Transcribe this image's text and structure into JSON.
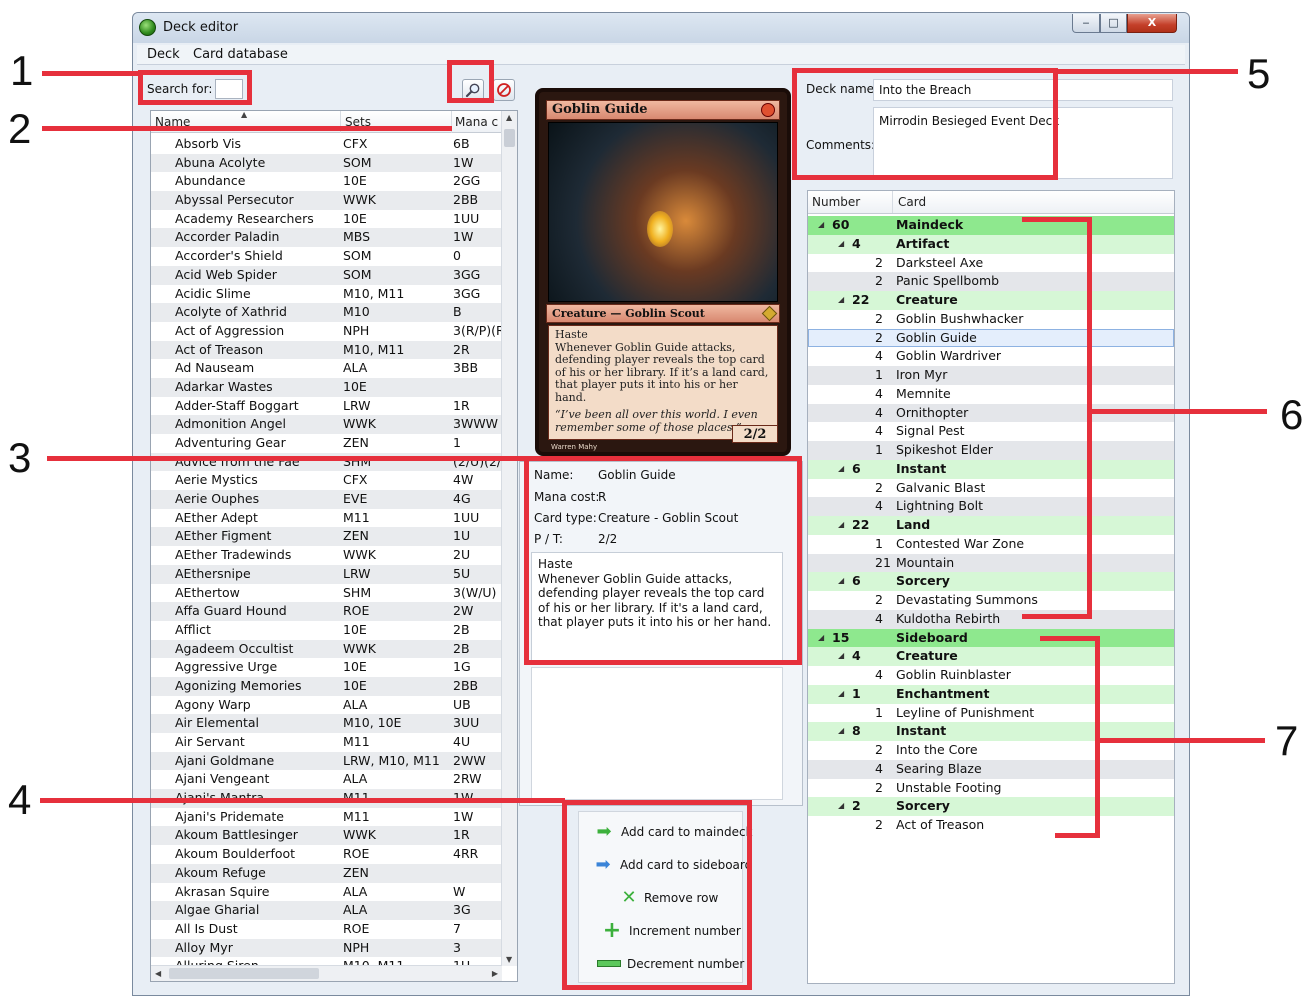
{
  "window": {
    "title": "Deck editor",
    "controls": {
      "minimize": "‒",
      "maximize": "□",
      "close": "X"
    }
  },
  "menu": [
    "Deck",
    "Card database"
  ],
  "search": {
    "label": "Search for:",
    "value": ""
  },
  "card_list": {
    "columns": [
      "Name",
      "Sets",
      "Mana c"
    ],
    "rows": [
      [
        "Absorb Vis",
        "CFX",
        "6B"
      ],
      [
        "Abuna Acolyte",
        "SOM",
        "1W"
      ],
      [
        "Abundance",
        "10E",
        "2GG"
      ],
      [
        "Abyssal Persecutor",
        "WWK",
        "2BB"
      ],
      [
        "Academy Researchers",
        "10E",
        "1UU"
      ],
      [
        "Accorder Paladin",
        "MBS",
        "1W"
      ],
      [
        "Accorder's Shield",
        "SOM",
        "0"
      ],
      [
        "Acid Web Spider",
        "SOM",
        "3GG"
      ],
      [
        "Acidic Slime",
        "M10, M11",
        "3GG"
      ],
      [
        "Acolyte of Xathrid",
        "M10",
        "B"
      ],
      [
        "Act of Aggression",
        "NPH",
        "3(R/P)(R/P)"
      ],
      [
        "Act of Treason",
        "M10, M11",
        "2R"
      ],
      [
        "Ad Nauseam",
        "ALA",
        "3BB"
      ],
      [
        "Adarkar Wastes",
        "10E",
        ""
      ],
      [
        "Adder-Staff Boggart",
        "LRW",
        "1R"
      ],
      [
        "Admonition Angel",
        "WWK",
        "3WWW"
      ],
      [
        "Adventuring Gear",
        "ZEN",
        "1"
      ],
      [
        "Advice from the Fae",
        "SHM",
        "(2/U)(2/U)(2/U)"
      ],
      [
        "Aerie Mystics",
        "CFX",
        "4W"
      ],
      [
        "Aerie Ouphes",
        "EVE",
        "4G"
      ],
      [
        "AEther Adept",
        "M11",
        "1UU"
      ],
      [
        "AEther Figment",
        "ZEN",
        "1U"
      ],
      [
        "AEther Tradewinds",
        "WWK",
        "2U"
      ],
      [
        "AEthersnipe",
        "LRW",
        "5U"
      ],
      [
        "AEthertow",
        "SHM",
        "3(W/U)"
      ],
      [
        "Affa Guard Hound",
        "ROE",
        "2W"
      ],
      [
        "Afflict",
        "10E",
        "2B"
      ],
      [
        "Agadeem Occultist",
        "WWK",
        "2B"
      ],
      [
        "Aggressive Urge",
        "10E",
        "1G"
      ],
      [
        "Agonizing Memories",
        "10E",
        "2BB"
      ],
      [
        "Agony Warp",
        "ALA",
        "UB"
      ],
      [
        "Air Elemental",
        "M10, 10E",
        "3UU"
      ],
      [
        "Air Servant",
        "M11",
        "4U"
      ],
      [
        "Ajani Goldmane",
        "LRW, M10, M11",
        "2WW"
      ],
      [
        "Ajani Vengeant",
        "ALA",
        "2RW"
      ],
      [
        "Ajani's Mantra",
        "M11",
        "1W"
      ],
      [
        "Ajani's Pridemate",
        "M11",
        "1W"
      ],
      [
        "Akoum Battlesinger",
        "WWK",
        "1R"
      ],
      [
        "Akoum Boulderfoot",
        "ROE",
        "4RR"
      ],
      [
        "Akoum Refuge",
        "ZEN",
        ""
      ],
      [
        "Akrasan Squire",
        "ALA",
        "W"
      ],
      [
        "Algae Gharial",
        "ALA",
        "3G"
      ],
      [
        "All Is Dust",
        "ROE",
        "7"
      ],
      [
        "Alloy Myr",
        "NPH",
        "3"
      ],
      [
        "Alluring Siren",
        "M10, M11",
        "1U"
      ]
    ]
  },
  "card_image": {
    "title": "Goblin Guide",
    "type_line": "Creature — Goblin Scout",
    "rules": "Haste\nWhenever Goblin Guide attacks, defending player reveals the top card of his or her library. If it’s a land card, that player puts it into his or her hand.",
    "flavor": "“I’ve been all over this world. I even remember some of those places.”",
    "pt": "2/2",
    "artist": "Warren Mahy"
  },
  "card_info": {
    "name_label": "Name:",
    "name": "Goblin Guide",
    "cost_label": "Mana cost:",
    "cost": "R",
    "type_label": "Card type:",
    "type": "Creature - Goblin Scout",
    "pt_label": "P / T:",
    "pt": "2/2",
    "text": "Haste\nWhenever Goblin Guide attacks, defending player reveals the top card of his or her library. If it's a land card, that player puts it into his or her hand."
  },
  "actions": [
    {
      "label": "Add card to maindeck",
      "icon": "green-right-arrow-icon"
    },
    {
      "label": "Add card to sideboard",
      "icon": "blue-right-arrow-icon"
    },
    {
      "label": "Remove row",
      "icon": "green-x-icon"
    },
    {
      "label": "Increment number",
      "icon": "plus-icon"
    },
    {
      "label": "Decrement number",
      "icon": "minus-icon"
    }
  ],
  "deck": {
    "name_label": "Deck name:",
    "name": "Into the Breach",
    "comments_label": "Comments:",
    "comments": "Mirrodin Besieged Event Deck"
  },
  "deck_tree": {
    "columns": [
      "Number",
      "Card"
    ],
    "rows": [
      {
        "kind": "zone",
        "num": "60",
        "name": "Maindeck"
      },
      {
        "kind": "type",
        "num": "4",
        "name": "Artifact"
      },
      {
        "kind": "card",
        "num": "2",
        "name": "Darksteel Axe"
      },
      {
        "kind": "card",
        "num": "2",
        "name": "Panic Spellbomb"
      },
      {
        "kind": "type",
        "num": "22",
        "name": "Creature"
      },
      {
        "kind": "card",
        "num": "2",
        "name": "Goblin Bushwhacker"
      },
      {
        "kind": "card",
        "num": "2",
        "name": "Goblin Guide",
        "selected": true
      },
      {
        "kind": "card",
        "num": "4",
        "name": "Goblin Wardriver"
      },
      {
        "kind": "card",
        "num": "1",
        "name": "Iron Myr"
      },
      {
        "kind": "card",
        "num": "4",
        "name": "Memnite"
      },
      {
        "kind": "card",
        "num": "4",
        "name": "Ornithopter"
      },
      {
        "kind": "card",
        "num": "4",
        "name": "Signal Pest"
      },
      {
        "kind": "card",
        "num": "1",
        "name": "Spikeshot Elder"
      },
      {
        "kind": "type",
        "num": "6",
        "name": "Instant"
      },
      {
        "kind": "card",
        "num": "2",
        "name": "Galvanic Blast"
      },
      {
        "kind": "card",
        "num": "4",
        "name": "Lightning Bolt"
      },
      {
        "kind": "type",
        "num": "22",
        "name": "Land"
      },
      {
        "kind": "card",
        "num": "1",
        "name": "Contested War Zone"
      },
      {
        "kind": "card",
        "num": "21",
        "name": "Mountain"
      },
      {
        "kind": "type",
        "num": "6",
        "name": "Sorcery"
      },
      {
        "kind": "card",
        "num": "2",
        "name": "Devastating Summons"
      },
      {
        "kind": "card",
        "num": "4",
        "name": "Kuldotha Rebirth"
      },
      {
        "kind": "zone",
        "num": "15",
        "name": "Sideboard"
      },
      {
        "kind": "type",
        "num": "4",
        "name": "Creature"
      },
      {
        "kind": "card",
        "num": "4",
        "name": "Goblin Ruinblaster"
      },
      {
        "kind": "type",
        "num": "1",
        "name": "Enchantment"
      },
      {
        "kind": "card",
        "num": "1",
        "name": "Leyline of Punishment"
      },
      {
        "kind": "type",
        "num": "8",
        "name": "Instant"
      },
      {
        "kind": "card",
        "num": "2",
        "name": "Into the Core"
      },
      {
        "kind": "card",
        "num": "4",
        "name": "Searing Blaze"
      },
      {
        "kind": "card",
        "num": "2",
        "name": "Unstable Footing"
      },
      {
        "kind": "type",
        "num": "2",
        "name": "Sorcery"
      },
      {
        "kind": "card",
        "num": "2",
        "name": "Act of Treason"
      }
    ]
  },
  "annotations": [
    "1",
    "2",
    "3",
    "4",
    "5",
    "6",
    "7"
  ],
  "colors": {
    "annotation": "#e6303c",
    "zone_row": "#8ee88e",
    "type_row": "#d6f7d6"
  }
}
